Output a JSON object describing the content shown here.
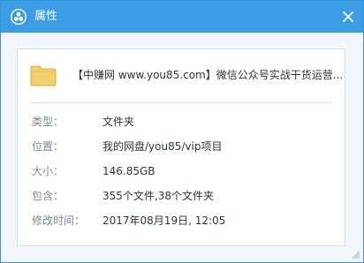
{
  "window": {
    "title": "属性",
    "icon": "cloud-icon",
    "close_icon": "close-icon"
  },
  "file": {
    "name": "【中赚网 www.you85.com】微信公众号实战干货运营...",
    "icon": "folder-icon"
  },
  "properties": [
    {
      "label": "类型：",
      "value": "文件夹"
    },
    {
      "label": "位置：",
      "value": "我的网盘/you85/vip项目"
    },
    {
      "label": "大小：",
      "value": "146.85GB"
    },
    {
      "label": "包含：",
      "value": "355个文件,38个文件夹"
    },
    {
      "label": "修改时间：",
      "value": "2017年08月19日, 12:05"
    }
  ],
  "colors": {
    "titlebar": "#3b9ee5",
    "border": "#2f96dd",
    "folder": "#f2cf6b"
  }
}
